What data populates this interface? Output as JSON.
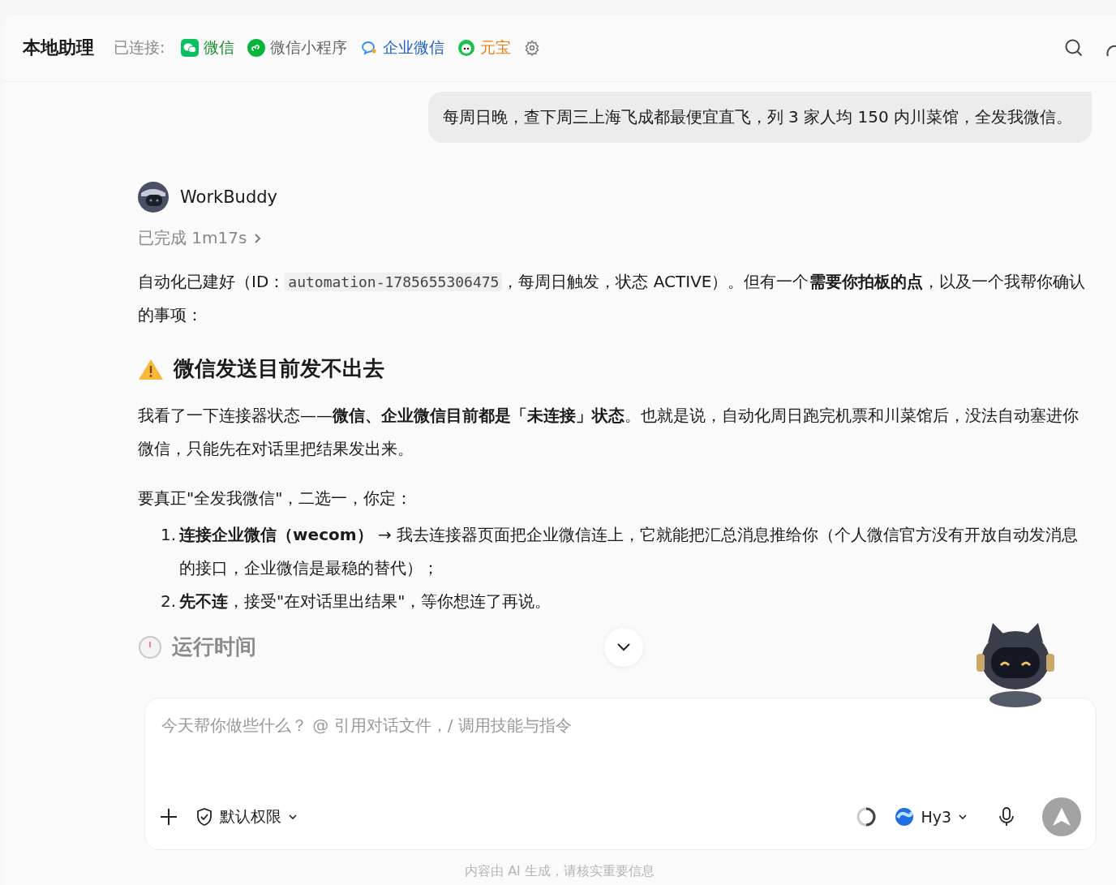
{
  "header": {
    "title": "本地助理",
    "connected_label": "已连接:",
    "connectors": [
      {
        "kind": "wechat",
        "label": "微信",
        "color": "#1a8f2e"
      },
      {
        "kind": "miniprogram",
        "label": "微信小程序",
        "color": "#666666"
      },
      {
        "kind": "wecom",
        "label": "企业微信",
        "color": "#1a5fc4"
      },
      {
        "kind": "yuanbao",
        "label": "元宝",
        "color": "#f07a12"
      }
    ]
  },
  "user_message": "每周日晚，查下周三上海飞成都最便宜直飞，列 3 家人均 150 内川菜馆，全发我微信。",
  "assistant": {
    "name": "WorkBuddy",
    "status": "已完成 1m17s",
    "intro": {
      "before": "自动化已建好（ID：",
      "code": "automation-1785655306475",
      "after": "，每周日触发，状态 ACTIVE）。但有一个**需要你拍板的点**，以及一个我帮你确认的事项："
    },
    "warning_heading": "微信发送目前发不出去",
    "paragraphs": [
      "我看了一下连接器状态——**微信、企业微信目前都是「未连接」状态**。也就是说，自动化周日跑完机票和川菜馆后，没法自动塞进你微信，只能先在对话里把结果发出来。",
      "要真正\"全发我微信\"，二选一，你定："
    ],
    "options": [
      {
        "number": "1.",
        "text": "**连接企业微信（wecom）** → 我去连接器页面把企业微信连上，它就能把汇总消息推给你（个人微信官方没有开放自动发消息的接口，企业微信是最稳的替代）；"
      },
      {
        "number": "2.",
        "text": "**先不连**，接受\"在对话里出结果\"，等你想连了再说。"
      }
    ],
    "next_heading": "运行时间"
  },
  "composer": {
    "placeholder": "今天帮你做些什么？ @ 引用对话文件，/ 调用技能与指令",
    "permission": "默认权限",
    "model": "Hy3"
  },
  "footer_note": "内容由 AI 生成，请核实重要信息"
}
